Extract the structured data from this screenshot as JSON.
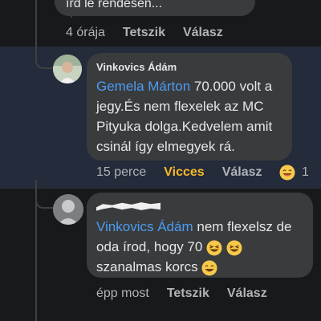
{
  "top_comment": {
    "text_fragment": "írd le rendesen...",
    "time": "4 órája",
    "like_label": "Tetszik",
    "reply_label": "Válasz"
  },
  "comment_1": {
    "author": "Vinkovics Ádám",
    "mention": "Gemela Márton",
    "text_line1": " 70.000 volt a",
    "text_line2": "jegy.És nem flexelek az MC",
    "text_line3": "Pityuka dolga.Kedvelem amit",
    "text_line4": "csinál így elmegyek rá.",
    "time": "15 perce",
    "reaction_label": "Vicces",
    "reply_label": "Válasz",
    "reaction_icon": "laughing-emoji-icon",
    "reaction_count": "1"
  },
  "comment_2": {
    "mention": "Vinkovics Ádám",
    "text_line1": " nem flexelsz de",
    "text_line2": "oda írod, hogy 70",
    "text_line3": "szanalmas korcs",
    "time": "épp most",
    "like_label": "Tetszik",
    "reply_label": "Válasz"
  },
  "colors": {
    "background": "#18191a",
    "bubble": "#3a3b3c",
    "highlight": "#242b3a",
    "mention": "#4b9cf5",
    "vicces": "#f7b928"
  }
}
